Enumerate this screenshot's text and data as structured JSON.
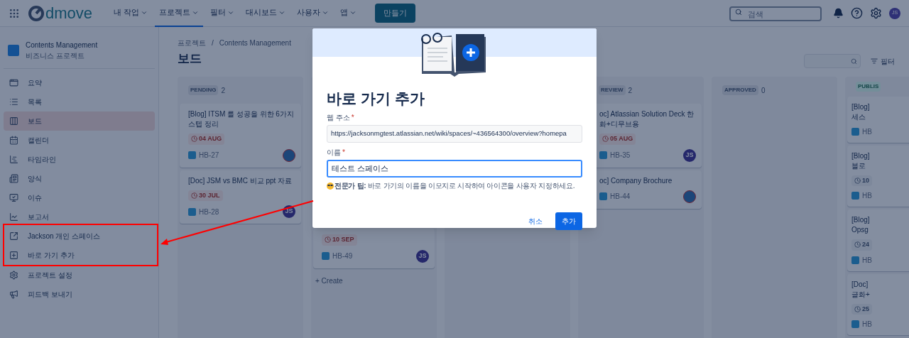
{
  "topbar": {
    "logo": "dmove",
    "nav": [
      {
        "label": "내 작업",
        "selected": false
      },
      {
        "label": "프로젝트",
        "selected": true
      },
      {
        "label": "필터",
        "selected": false
      },
      {
        "label": "대시보드",
        "selected": false
      },
      {
        "label": "사용자",
        "selected": false
      },
      {
        "label": "앱",
        "selected": false
      }
    ],
    "create_button": "만들기",
    "search": {
      "placeholder": "검색"
    },
    "avatar": "JS"
  },
  "sidebar": {
    "project": {
      "name": "Contents Management",
      "type": "비즈니스 프로젝트"
    },
    "items": [
      {
        "label": "요약",
        "selected": false
      },
      {
        "label": "목록",
        "selected": false
      },
      {
        "label": "보드",
        "selected": true
      },
      {
        "label": "캘린더",
        "selected": false
      },
      {
        "label": "타임라인",
        "selected": false
      },
      {
        "label": "양식",
        "selected": false
      },
      {
        "label": "이슈",
        "selected": false
      },
      {
        "label": "보고서",
        "selected": false
      },
      {
        "label": "Jackson 개인 스페이스",
        "selected": false
      },
      {
        "label": "바로 가기 추가",
        "selected": false
      },
      {
        "label": "프로젝트 설정",
        "selected": false
      },
      {
        "label": "피드백 보내기",
        "selected": false
      }
    ]
  },
  "board": {
    "breadcrumb": [
      "프로젝트",
      "Contents Management"
    ],
    "breadcrumb_separator": "/",
    "title": "보드",
    "filter_button": "필터",
    "columns": [
      {
        "name": "PENDING",
        "count": "2",
        "cards": [
          {
            "title": "[Blog] ITSM 를 성공을 위한 6가지 스텝 정리",
            "due": "04 AUG",
            "key": "HB-27",
            "avatar": {
              "kind": "picture"
            }
          },
          {
            "title": "[Doc] JSM vs BMC 비교 ppt 자료",
            "due": "30 JUL",
            "key": "HB-28",
            "avatar": {
              "kind": "initials",
              "text": "JS"
            }
          }
        ]
      },
      {
        "cards": [
          {
            "due": "10 SEP",
            "key": "HB-49",
            "avatar": {
              "kind": "initials",
              "text": "JS"
            }
          }
        ],
        "create": "+ Create"
      },
      {},
      {
        "name": "REVIEW",
        "count": "2",
        "cards": [
          {
            "title": "oc] Atlassian Solution Deck 한\n화+디무브용",
            "due": "05 AUG",
            "key": "HB-35",
            "avatar": {
              "kind": "initials",
              "text": "JS"
            }
          },
          {
            "title": "oc] Company Brochure",
            "key": "HB-44",
            "avatar": {
              "kind": "picture"
            }
          }
        ]
      },
      {
        "name": "APPROVED",
        "count": "0"
      },
      {
        "name": "PUBLIS",
        "cards": [
          {
            "title": "[Blog]\n세스",
            "key": "HB"
          },
          {
            "title": "[Blog]\n블로",
            "due": "10",
            "key": "HB"
          },
          {
            "title": "[Blog]\nOpsg",
            "due": "24",
            "key": "HB"
          },
          {
            "title": "[Doc]\n글화+",
            "due": "25",
            "key": "HB"
          }
        ]
      }
    ]
  },
  "dialog": {
    "title": "바로 가기 추가",
    "fields": [
      {
        "label": "웹 주소",
        "required_mark": "*",
        "value": "https://jacksonmgtest.atlassian.net/wiki/spaces/~436564300/overview?homepa",
        "focused": false
      },
      {
        "label": "이름",
        "required_mark": "*",
        "value": "테스트 스페이스",
        "focused": true
      }
    ],
    "tip": "**전문가 팁:** 바로 가기의 이름을 이모지로 시작하여 아이콘을 사용자 지정하세요.",
    "cancel": "취소",
    "submit": "추가"
  }
}
